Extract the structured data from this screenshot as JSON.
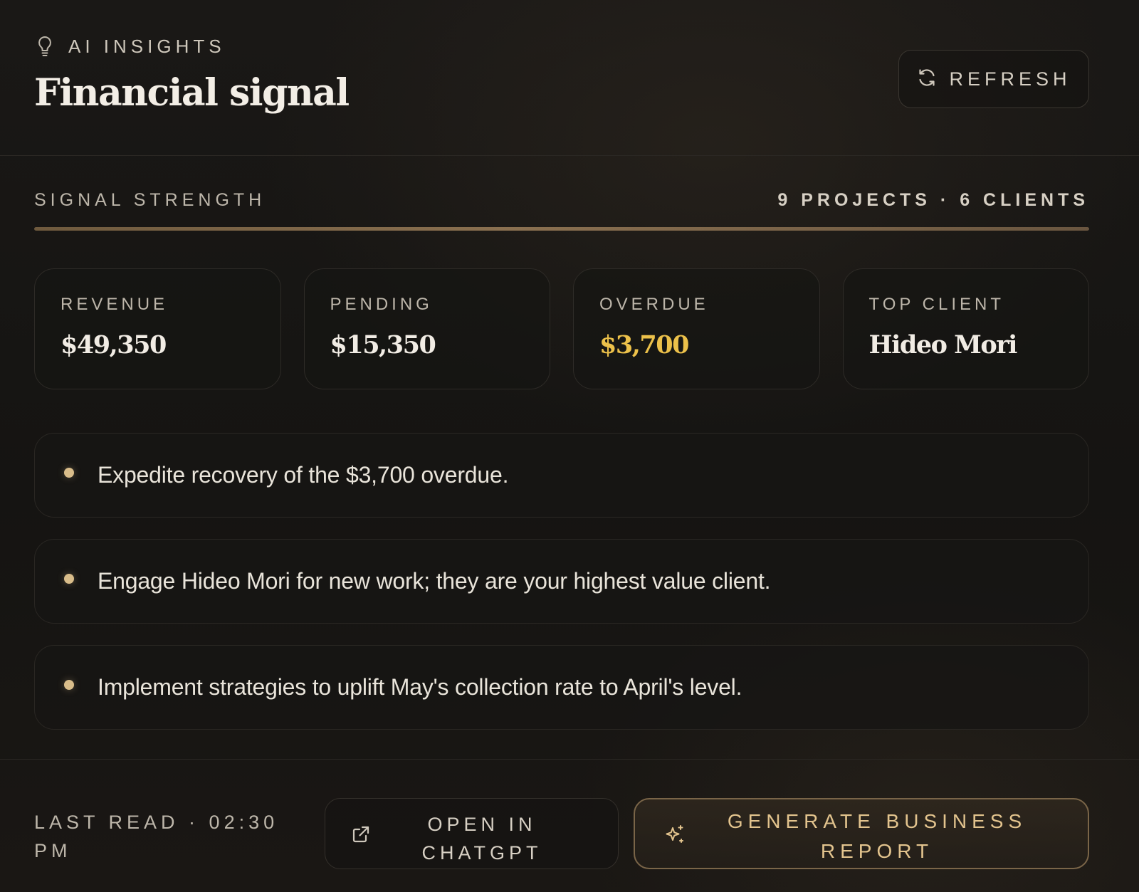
{
  "header": {
    "eyebrow": "AI INSIGHTS",
    "title": "Financial signal",
    "refresh_label": "REFRESH"
  },
  "signal": {
    "label": "SIGNAL STRENGTH",
    "meta": "9 PROJECTS · 6 CLIENTS",
    "strength": 1.0
  },
  "metrics": [
    {
      "label": "REVENUE",
      "value": "$49,350"
    },
    {
      "label": "PENDING",
      "value": "$15,350"
    },
    {
      "label": "OVERDUE",
      "value": "$3,700"
    },
    {
      "label": "TOP CLIENT",
      "value": "Hideo Mori"
    }
  ],
  "insights": [
    "Expedite recovery of the $3,700 overdue.",
    "Engage Hideo Mori for new work; they are your highest value client.",
    "Implement strategies to uplift May's collection rate to April's level."
  ],
  "footer": {
    "last_read": "LAST READ · 02:30 PM",
    "open_label": "OPEN IN CHATGPT",
    "generate_label": "GENERATE BUSINESS REPORT"
  },
  "colors": {
    "background": "#161513",
    "accent_gold": "#e3c48e",
    "overdue": "#ecc14a",
    "bullet": "#d9bd8a"
  },
  "icons": {
    "eyebrow": "lightbulb-icon",
    "refresh": "refresh-icon",
    "open": "external-link-icon",
    "generate": "sparkle-icon"
  }
}
